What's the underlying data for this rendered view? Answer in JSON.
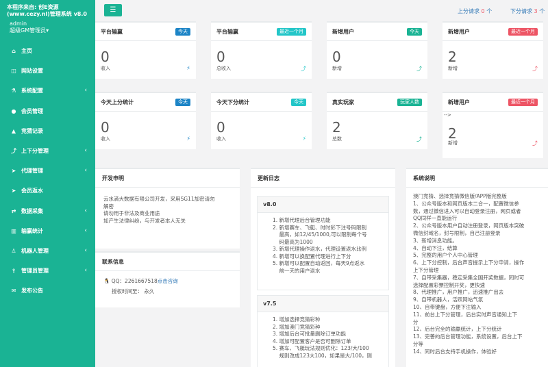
{
  "brand": {
    "line1": "本程序来自: 创E资源",
    "line2": "(www.cezy.nl)管理系统 v8.0"
  },
  "admin": {
    "name": "admin",
    "role": "超级GM管理员▾"
  },
  "menu": [
    {
      "label": "主页",
      "icon": "home-icon",
      "glyph": "⌂",
      "caret": false
    },
    {
      "label": "网站设置",
      "icon": "columns-icon",
      "glyph": "◫",
      "caret": false
    },
    {
      "label": "系统配置",
      "icon": "flask-icon",
      "glyph": "⚗",
      "caret": true
    },
    {
      "label": "会员管理",
      "icon": "user-icon",
      "glyph": "●",
      "caret": false
    },
    {
      "label": "竞猜记录",
      "icon": "car-icon",
      "glyph": "▲",
      "caret": false
    },
    {
      "label": "上下分管理",
      "icon": "level-up-icon",
      "glyph": "⤴",
      "caret": true
    },
    {
      "label": "代理管理",
      "icon": "send-icon",
      "glyph": "➤",
      "caret": true
    },
    {
      "label": "会员返水",
      "icon": "send-icon",
      "glyph": "➤",
      "caret": false
    },
    {
      "label": "数据采集",
      "icon": "shuffle-icon",
      "glyph": "⇄",
      "caret": true
    },
    {
      "label": "输赢统计",
      "icon": "bar-chart-icon",
      "glyph": "▥",
      "caret": true
    },
    {
      "label": "机器人管理",
      "icon": "male-icon",
      "glyph": "♙",
      "caret": true
    },
    {
      "label": "管理员管理",
      "icon": "upload-icon",
      "glyph": "⇪",
      "caret": true
    },
    {
      "label": "发布公告",
      "icon": "comments-icon",
      "glyph": "✉",
      "caret": false
    }
  ],
  "topbar": {
    "toggle_icon": "bars-icon",
    "up_label": "上分请求",
    "up_count": "0",
    "up_unit": "个",
    "down_label": "下分请求",
    "down_count": "3",
    "down_unit": "个"
  },
  "stats": [
    {
      "title": "平台输赢",
      "badge": "今天",
      "badge_color": "blue",
      "value": "0",
      "label": "收入",
      "arrow": "⚡",
      "arrow_color": "#1c84c6"
    },
    {
      "title": "平台输赢",
      "badge": "最近一个月",
      "badge_color": "cyan",
      "value": "0",
      "label": "总收入",
      "arrow": "⤴",
      "arrow_color": "#23c6c8"
    },
    {
      "title": "新增用户",
      "badge": "今天",
      "badge_color": "green",
      "value": "0",
      "label": "新增",
      "arrow": "⤴",
      "arrow_color": "#1ab394"
    },
    {
      "title": "新增用户",
      "badge": "最近一个月",
      "badge_color": "red",
      "value": "2",
      "label": "新增",
      "arrow": "⤴",
      "arrow_color": "#ed5565"
    },
    {
      "title": "今天上分统计",
      "badge": "今天",
      "badge_color": "blue",
      "value": "0",
      "label": "收入",
      "arrow": "⚡",
      "arrow_color": "#1c84c6"
    },
    {
      "title": "今天下分统计",
      "badge": "今天",
      "badge_color": "cyan",
      "value": "0",
      "label": "收入",
      "arrow": "⚡",
      "arrow_color": "#23c6c8"
    },
    {
      "title": "真实玩家",
      "badge": "玩家人数",
      "badge_color": "green",
      "value": "2",
      "label": "总数",
      "arrow": "⤴",
      "arrow_color": "#1ab394"
    },
    {
      "title": "新增用户",
      "badge": "最近一个月",
      "badge_color": "red",
      "value": "2",
      "label": "新增",
      "arrow": "⤴",
      "arrow_color": "#ed5565",
      "prefix": "-->"
    }
  ],
  "dev": {
    "title": "开发申明",
    "lines": [
      "云水滴大数据有限公司开发，采用SG11加密请勿",
      "解密",
      "请勿用于非法及商业用途",
      "如产生法律纠纷，与开发者本人无关"
    ]
  },
  "contact": {
    "title": "联系信息",
    "qq_label": "QQ：2261667518",
    "qq_link": "点击咨询",
    "auth_label": "授权时间至：",
    "auth_value": "永久"
  },
  "changelog": {
    "title": "更新日志",
    "v1": {
      "name": "v8.0",
      "items": [
        "1. 新增代理后台管理功能",
        "2. 新增赛车、飞艇、时时彩下注号码限制",
        "    最高，如12/45/1000,可以限制每个号",
        "    码最高为1000",
        "3. 新增代理操作返水，代理设置返水比例",
        "4. 新增可以换配置代理进行上下分",
        "5. 新增可以配置自动返回，每天9点返水",
        "    前一天的用户返水"
      ]
    },
    "v2": {
      "name": "v7.5",
      "items": [
        "1. 增加选择竞猜彩种",
        "2. 增加澳门竞猜彩种",
        "3. 增加后台可批量删除订单功能",
        "4. 增加可配置客户是否可删除订单",
        "5. 赛车、飞艇玩法规则优化：123/大/100",
        "    规则改成123大100，如果是大/100，则"
      ]
    }
  },
  "sysinfo": {
    "title": "系统说明",
    "lines": [
      "澳门竞猜、选择竞猜微信版/APP版完整版",
      "1、公众号版本和网页版本二合一，配置微信参",
      "数，通过微信进入可以自动登录注册，网页或者",
      "QQ同样一直能运行",
      "2、公众号版本用户自动注册登录，网页版本突破",
      "微信封域名，封号限制，自己注册登录",
      "3、新增消息功能。",
      "4、自动下注，结算",
      "5、完整的用户个人中心管理",
      "6、上下分控制，后台声音提示上下分申请，操作",
      "上下分管理",
      "7、自带采集器，稳定采集全国开奖数据，同时可",
      "选择配置彩票控制开奖，更快速",
      "8、代理推广，用户推广，迅速推广出去",
      "9、自带机器人，活跃网站气氛",
      "10、自带键盘，方便下注输入",
      "11、前台上下分管理，后台实时声音通知上下",
      "分",
      "12、后台完全的输赢统计，上下分统计",
      "13、完善的后台管理功能，系统设置，后台上下",
      "分等",
      "14、同时后台支持手机操作，体验好"
    ]
  }
}
